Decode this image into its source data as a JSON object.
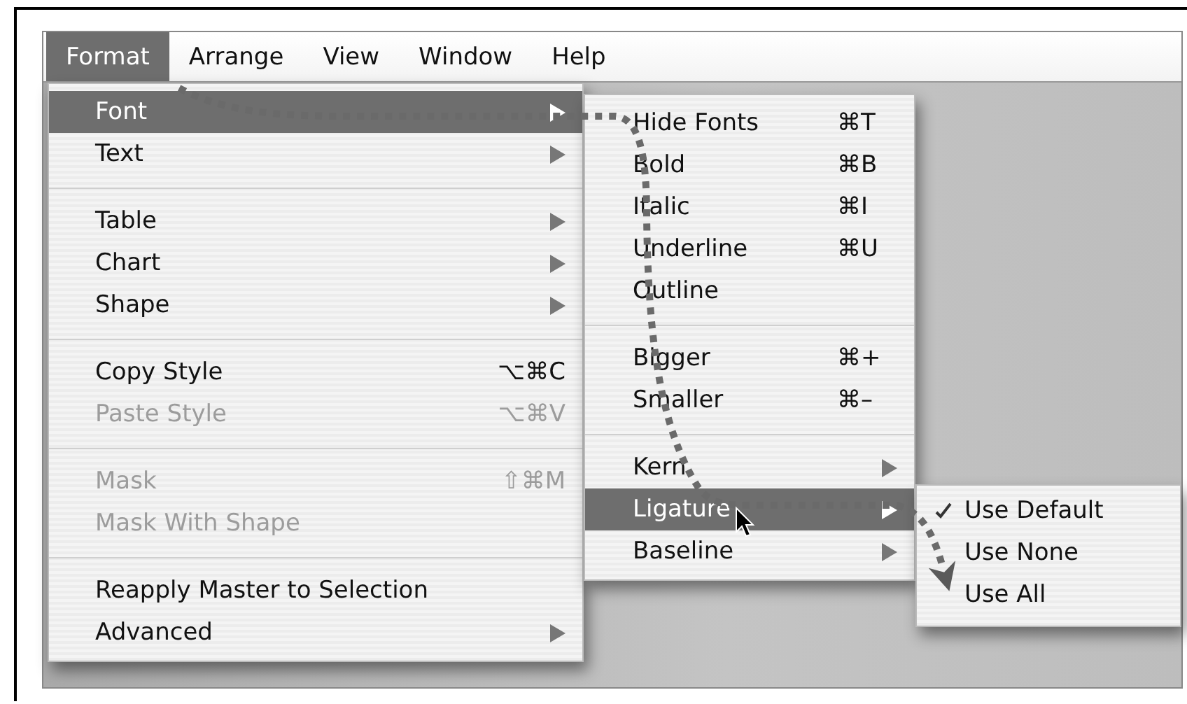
{
  "menubar": [
    {
      "label": "Format",
      "selected": true
    },
    {
      "label": "Arrange",
      "selected": false
    },
    {
      "label": "View",
      "selected": false
    },
    {
      "label": "Window",
      "selected": false
    },
    {
      "label": "Help",
      "selected": false
    }
  ],
  "format_menu": {
    "items": [
      {
        "kind": "item",
        "label": "Font",
        "submenu": true,
        "selected": true,
        "disabled": false
      },
      {
        "kind": "item",
        "label": "Text",
        "submenu": true,
        "selected": false,
        "disabled": false
      },
      {
        "kind": "separator"
      },
      {
        "kind": "item",
        "label": "Table",
        "submenu": true,
        "selected": false,
        "disabled": false
      },
      {
        "kind": "item",
        "label": "Chart",
        "submenu": true,
        "selected": false,
        "disabled": false
      },
      {
        "kind": "item",
        "label": "Shape",
        "submenu": true,
        "selected": false,
        "disabled": false
      },
      {
        "kind": "separator"
      },
      {
        "kind": "item",
        "label": "Copy Style",
        "shortcut": "⌥⌘C",
        "selected": false,
        "disabled": false
      },
      {
        "kind": "item",
        "label": "Paste Style",
        "shortcut": "⌥⌘V",
        "selected": false,
        "disabled": true
      },
      {
        "kind": "separator"
      },
      {
        "kind": "item",
        "label": "Mask",
        "shortcut": "⇧⌘M",
        "selected": false,
        "disabled": true
      },
      {
        "kind": "item",
        "label": "Mask With Shape",
        "selected": false,
        "disabled": true
      },
      {
        "kind": "separator"
      },
      {
        "kind": "item",
        "label": "Reapply Master to Selection",
        "selected": false,
        "disabled": false
      },
      {
        "kind": "item",
        "label": "Advanced",
        "submenu": true,
        "selected": false,
        "disabled": false
      }
    ]
  },
  "font_submenu": {
    "items": [
      {
        "kind": "item",
        "label": "Hide Fonts",
        "shortcut": "⌘T",
        "selected": false,
        "disabled": false
      },
      {
        "kind": "item",
        "label": "Bold",
        "shortcut": "⌘B",
        "selected": false,
        "disabled": false
      },
      {
        "kind": "item",
        "label": "Italic",
        "shortcut": "⌘I",
        "selected": false,
        "disabled": false
      },
      {
        "kind": "item",
        "label": "Underline",
        "shortcut": "⌘U",
        "selected": false,
        "disabled": false
      },
      {
        "kind": "item",
        "label": "Outline",
        "selected": false,
        "disabled": false
      },
      {
        "kind": "separator"
      },
      {
        "kind": "item",
        "label": "Bigger",
        "shortcut": "⌘+",
        "selected": false,
        "disabled": false
      },
      {
        "kind": "item",
        "label": "Smaller",
        "shortcut": "⌘–",
        "selected": false,
        "disabled": false
      },
      {
        "kind": "separator"
      },
      {
        "kind": "item",
        "label": "Kern",
        "submenu": true,
        "selected": false,
        "disabled": false
      },
      {
        "kind": "item",
        "label": "Ligature",
        "submenu": true,
        "selected": true,
        "disabled": false
      },
      {
        "kind": "item",
        "label": "Baseline",
        "submenu": true,
        "selected": false,
        "disabled": false
      }
    ]
  },
  "ligature_submenu": {
    "items": [
      {
        "kind": "item",
        "label": "Use Default",
        "checked": true,
        "selected": false,
        "disabled": false
      },
      {
        "kind": "item",
        "label": "Use None",
        "checked": false,
        "selected": false,
        "disabled": false
      },
      {
        "kind": "item",
        "label": "Use All",
        "checked": false,
        "selected": false,
        "disabled": false
      }
    ]
  }
}
